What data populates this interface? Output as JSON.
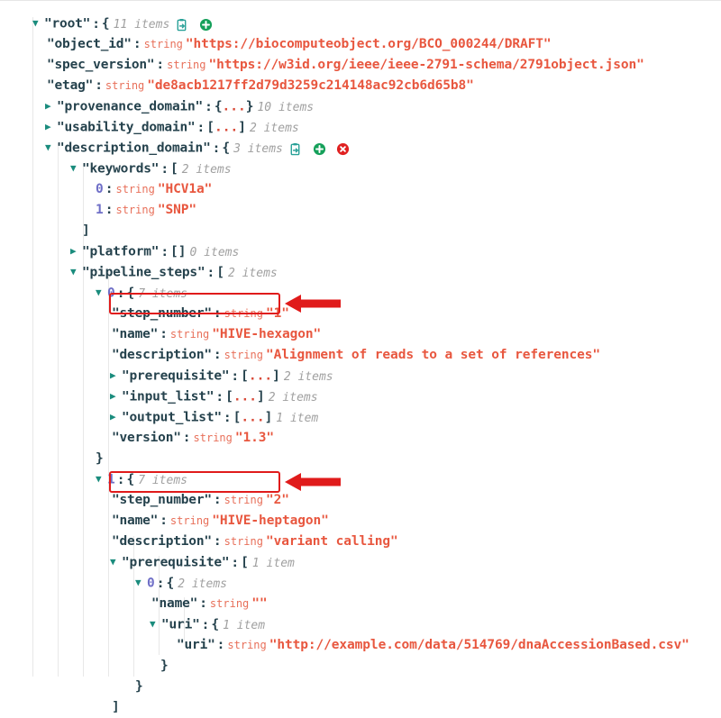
{
  "viewer": {
    "name": "json-tree-viewer",
    "root_label": "\"root\"",
    "string_type_label": "string"
  },
  "icons": {
    "paste": "paste-clipboard-icon",
    "add": "add-circle-icon",
    "remove": "remove-circle-icon"
  },
  "rows": [
    {
      "id": "root",
      "key": "\"root\"",
      "open": "{",
      "count": "11 items"
    },
    {
      "id": "object_id",
      "key": "\"object_id\"",
      "value": "\"https://biocomputeobject.org/BCO_000244/DRAFT\""
    },
    {
      "id": "spec_version",
      "key": "\"spec_version\"",
      "value": "\"https://w3id.org/ieee/ieee-2791-schema/2791object.json\""
    },
    {
      "id": "etag",
      "key": "\"etag\"",
      "value": "\"de8acb1217ff2d79d3259c214148ac92cb6d65b8\""
    },
    {
      "id": "provenance_domain",
      "key": "\"provenance_domain\"",
      "collapsed": "{...}",
      "count": "10 items"
    },
    {
      "id": "usability_domain",
      "key": "\"usability_domain\"",
      "collapsed": "[...]",
      "count": "2 items"
    },
    {
      "id": "description_domain",
      "key": "\"description_domain\"",
      "open": "{",
      "count": "3 items"
    },
    {
      "id": "keywords",
      "key": "\"keywords\"",
      "open": "[",
      "count": "2 items"
    },
    {
      "id": "keywords_0",
      "index": "0",
      "value": "\"HCV1a\""
    },
    {
      "id": "keywords_1",
      "index": "1",
      "value": "\"SNP\""
    },
    {
      "id": "keywords_close",
      "close": "]"
    },
    {
      "id": "platform",
      "key": "\"platform\"",
      "collapsed": "[]",
      "count": "0 items"
    },
    {
      "id": "pipeline_steps",
      "key": "\"pipeline_steps\"",
      "open": "[",
      "count": "2 items"
    },
    {
      "id": "step0",
      "index": "0",
      "open": "{",
      "count": "7 items"
    },
    {
      "id": "step0_step_number",
      "key": "\"step_number\"",
      "value": "\"1\""
    },
    {
      "id": "step0_name",
      "key": "\"name\"",
      "value": "\"HIVE-hexagon\""
    },
    {
      "id": "step0_description",
      "key": "\"description\"",
      "value": "\"Alignment of reads to a set of references\""
    },
    {
      "id": "step0_prerequisite",
      "key": "\"prerequisite\"",
      "collapsed": "[...]",
      "count": "2 items"
    },
    {
      "id": "step0_input_list",
      "key": "\"input_list\"",
      "collapsed": "[...]",
      "count": "2 items"
    },
    {
      "id": "step0_output_list",
      "key": "\"output_list\"",
      "collapsed": "[...]",
      "count": "1 item"
    },
    {
      "id": "step0_version",
      "key": "\"version\"",
      "value": "\"1.3\""
    },
    {
      "id": "step0_close",
      "close": "}"
    },
    {
      "id": "step1",
      "index": "1",
      "open": "{",
      "count": "7 items"
    },
    {
      "id": "step1_step_number",
      "key": "\"step_number\"",
      "value": "\"2\""
    },
    {
      "id": "step1_name",
      "key": "\"name\"",
      "value": "\"HIVE-heptagon\""
    },
    {
      "id": "step1_description",
      "key": "\"description\"",
      "value": "\"variant calling\""
    },
    {
      "id": "step1_prerequisite",
      "key": "\"prerequisite\"",
      "open": "[",
      "count": "1 item"
    },
    {
      "id": "step1_prereq_0",
      "index": "0",
      "open": "{",
      "count": "2 items"
    },
    {
      "id": "step1_prereq_0_name",
      "key": "\"name\"",
      "value": "\"\""
    },
    {
      "id": "step1_prereq_0_uri",
      "key": "\"uri\"",
      "open": "{",
      "count": "1 item"
    },
    {
      "id": "step1_prereq_0_uri_uri",
      "key": "\"uri\"",
      "value": "\"http://example.com/data/514769/dnaAccessionBased.csv\""
    },
    {
      "id": "uri_close",
      "close": "}"
    },
    {
      "id": "prereq_0_close",
      "close": "}"
    },
    {
      "id": "prereq_close",
      "close": "]"
    }
  ],
  "annotations": [
    {
      "id": "highlight-step-number-1",
      "label": "red-box-step-number-1",
      "target": "step0_step_number"
    },
    {
      "id": "arrow-step-number-1",
      "label": "red-arrow-step-number-1"
    },
    {
      "id": "highlight-step-number-2",
      "label": "red-box-step-number-2",
      "target": "step1_step_number"
    },
    {
      "id": "arrow-step-number-2",
      "label": "red-arrow-step-number-2"
    }
  ],
  "colors": {
    "key": "#25424d",
    "string": "#e8573f",
    "type": "#e8705a",
    "index": "#6f6fc7",
    "count": "#a0a0a0",
    "caret": "#1a8c7d",
    "icon_paste": "#2aa198",
    "icon_add": "#15a05a",
    "icon_remove": "#e02020",
    "annotation": "#e01b1b",
    "guide": "#e8e8e8"
  }
}
